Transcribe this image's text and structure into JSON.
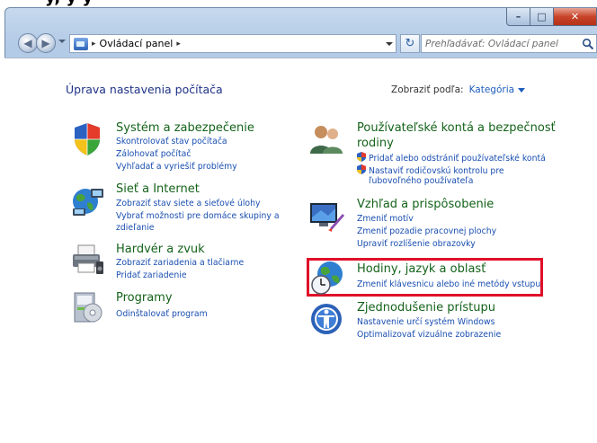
{
  "window": {
    "top_fragment": "y, y y",
    "minimize": "–",
    "maximize": "□",
    "close": "✕"
  },
  "navbar": {
    "address_separator": "▸",
    "address_text": "Ovládací panel",
    "address_trailing_separator": "▸",
    "refresh_symbol": "↻",
    "search_placeholder": "Prehľadávať: Ovládací panel"
  },
  "page": {
    "title": "Úprava nastavenia počítača",
    "view_by_label": "Zobraziť podľa:",
    "view_by_value": "Kategória"
  },
  "categories": {
    "system": {
      "title": "Systém a zabezpečenie",
      "links": [
        "Skontrolovať stav počítača",
        "Zálohovať počítač",
        "Vyhľadať a vyriešiť problémy"
      ]
    },
    "network": {
      "title": "Sieť a Internet",
      "links": [
        "Zobraziť stav siete a sieťové úlohy",
        "Vybrať možnosti pre domáce skupiny a",
        "zdieľanie"
      ]
    },
    "hardware": {
      "title": "Hardvér a zvuk",
      "links": [
        "Zobraziť zariadenia a tlačiarne",
        "Pridať zariadenie"
      ]
    },
    "programs": {
      "title": "Programy",
      "links": [
        "Odinštalovať program"
      ]
    },
    "users": {
      "title_line1": "Používateľské kontá a bezpečnosť",
      "title_line2": "rodiny",
      "links": [
        "Pridať alebo odstrániť používateľské kontá",
        "Nastaviť rodičovskú kontrolu pre",
        "ľubovoľného používateľa"
      ]
    },
    "appearance": {
      "title": "Vzhľad a prispôsobenie",
      "links": [
        "Zmeniť motív",
        "Zmeniť pozadie pracovnej plochy",
        "Upraviť rozlíšenie obrazovky"
      ]
    },
    "clock": {
      "title": "Hodiny, jazyk a oblasť",
      "links": [
        "Zmeniť klávesnicu alebo iné metódy vstupu"
      ]
    },
    "ease": {
      "title": "Zjednodušenie prístupu",
      "links": [
        "Nastavenie určí systém Windows",
        "Optimalizovať vizuálne zobrazenie"
      ]
    }
  },
  "colors": {
    "highlight": "#e0102a",
    "link": "#1a4fb0",
    "category_title": "#14631a",
    "page_title": "#1e3287"
  }
}
